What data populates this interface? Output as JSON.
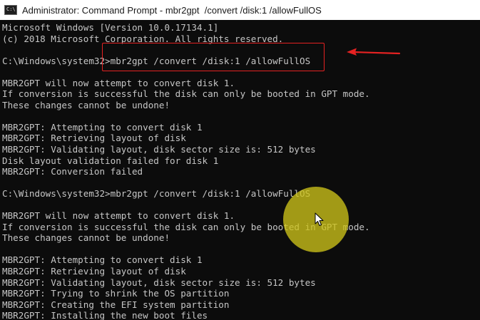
{
  "window": {
    "title": "Administrator: Command Prompt - mbr2gpt  /convert /disk:1 /allowFullOS",
    "icon": "command-prompt-icon",
    "icon_glyph": "C:\\"
  },
  "console": {
    "lines": [
      "Microsoft Windows [Version 10.0.17134.1]",
      "(c) 2018 Microsoft Corporation. All rights reserved.",
      "",
      "C:\\Windows\\system32>mbr2gpt /convert /disk:1 /allowFullOS",
      "",
      "MBR2GPT will now attempt to convert disk 1.",
      "If conversion is successful the disk can only be booted in GPT mode.",
      "These changes cannot be undone!",
      "",
      "MBR2GPT: Attempting to convert disk 1",
      "MBR2GPT: Retrieving layout of disk",
      "MBR2GPT: Validating layout, disk sector size is: 512 bytes",
      "Disk layout validation failed for disk 1",
      "MBR2GPT: Conversion failed",
      "",
      "C:\\Windows\\system32>mbr2gpt /convert /disk:1 /allowFullOS",
      "",
      "MBR2GPT will now attempt to convert disk 1.",
      "If conversion is successful the disk can only be booted in GPT mode.",
      "These changes cannot be undone!",
      "",
      "MBR2GPT: Attempting to convert disk 1",
      "MBR2GPT: Retrieving layout of disk",
      "MBR2GPT: Validating layout, disk sector size is: 512 bytes",
      "MBR2GPT: Trying to shrink the OS partition",
      "MBR2GPT: Creating the EFI system partition",
      "MBR2GPT: Installing the new boot files"
    ]
  },
  "annotations": {
    "highlight_color": "#e52222",
    "cursor_highlight_color": "#cdc319"
  },
  "colors": {
    "console_background": "#0c0c0c",
    "console_text": "#c6c6c6",
    "titlebar_background": "#ffffff"
  }
}
